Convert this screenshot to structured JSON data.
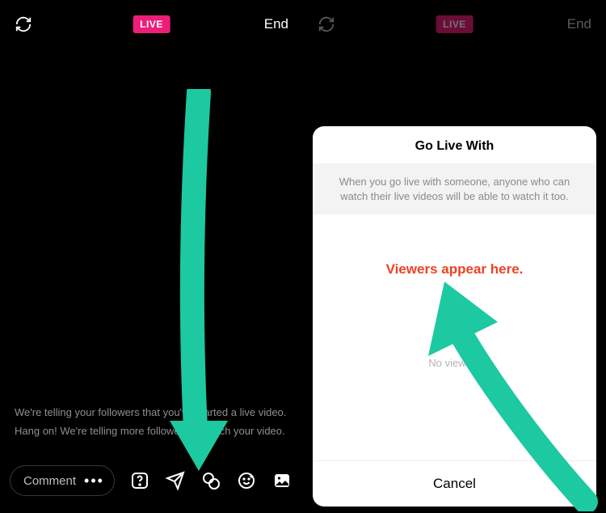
{
  "left": {
    "live_badge": "LIVE",
    "end_label": "End",
    "status_line1": "We're telling your followers that you've started a live video.",
    "status_line2": "Hang on! We're telling more followers to watch your video.",
    "comment_placeholder": "Comment"
  },
  "right": {
    "live_badge": "LIVE",
    "end_label": "End",
    "sheet": {
      "title": "Go Live With",
      "subtitle": "When you go live with someone, anyone who can watch their live videos will be able to watch it too.",
      "viewers_annotation": "Viewers appear here.",
      "no_viewers": "No viewers",
      "cancel": "Cancel"
    }
  },
  "colors": {
    "accent_teal": "#1dc9a0"
  }
}
